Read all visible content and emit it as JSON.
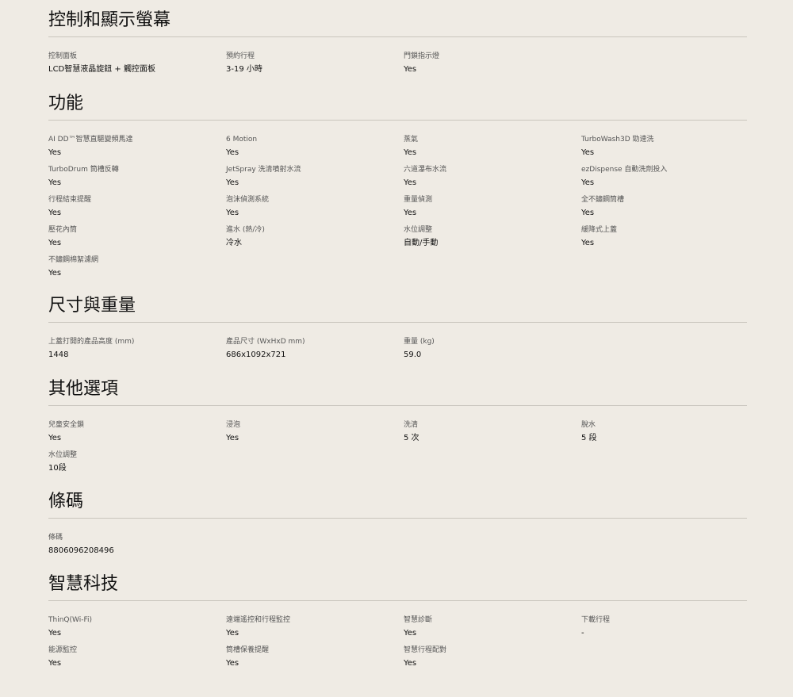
{
  "sections": [
    {
      "title": "控制和顯示螢幕",
      "specs": [
        {
          "label": "控制面板",
          "value": "LCD智慧液晶旋鈕 + 觸控面板"
        },
        {
          "label": "預約行程",
          "value": "3-19 小時"
        },
        {
          "label": "門鎖指示燈",
          "value": "Yes"
        }
      ]
    },
    {
      "title": "功能",
      "specs": [
        {
          "label": "AI DD™智慧直驅變頻馬達",
          "value": "Yes"
        },
        {
          "label": "6 Motion",
          "value": "Yes"
        },
        {
          "label": "蒸氣",
          "value": "Yes"
        },
        {
          "label": "TurboWash3D 勁速洗",
          "value": "Yes"
        },
        {
          "label": "TurboDrum 筒槽反轉",
          "value": "Yes"
        },
        {
          "label": "JetSpray 洗清噴射水流",
          "value": "Yes"
        },
        {
          "label": "六道瀑布水流",
          "value": "Yes"
        },
        {
          "label": "ezDispense 自動洗劑投入",
          "value": "Yes"
        },
        {
          "label": "行程結束提醒",
          "value": "Yes"
        },
        {
          "label": "泡沫偵測系統",
          "value": "Yes"
        },
        {
          "label": "重量偵測",
          "value": "Yes"
        },
        {
          "label": "全不鏽鋼筒槽",
          "value": "Yes"
        },
        {
          "label": "壓花內筒",
          "value": "Yes"
        },
        {
          "label": "進水 (熱/冷)",
          "value": "冷水"
        },
        {
          "label": "水位調整",
          "value": "自動/手動"
        },
        {
          "label": "緩降式上蓋",
          "value": "Yes"
        },
        {
          "label": "不鏽鋼棉絮濾網",
          "value": "Yes"
        }
      ]
    },
    {
      "title": "尺寸與重量",
      "specs": [
        {
          "label": "上蓋打開的產品高度 (mm)",
          "value": "1448"
        },
        {
          "label": "產品尺寸 (WxHxD mm)",
          "value": "686x1092x721"
        },
        {
          "label": "重量 (kg)",
          "value": "59.0"
        }
      ]
    },
    {
      "title": "其他選項",
      "specs": [
        {
          "label": "兒童安全鎖",
          "value": "Yes"
        },
        {
          "label": "浸泡",
          "value": "Yes"
        },
        {
          "label": "洗清",
          "value": "5 次"
        },
        {
          "label": "脫水",
          "value": "5 段"
        },
        {
          "label": "水位調整",
          "value": "10段"
        }
      ]
    },
    {
      "title": "條碼",
      "specs": [
        {
          "label": "條碼",
          "value": "8806096208496"
        }
      ]
    },
    {
      "title": "智慧科技",
      "specs": [
        {
          "label": "ThinQ(Wi-Fi)",
          "value": "Yes"
        },
        {
          "label": "遠端遙控和行程監控",
          "value": "Yes"
        },
        {
          "label": "智慧診斷",
          "value": "Yes"
        },
        {
          "label": "下載行程",
          "value": "-"
        },
        {
          "label": "能源監控",
          "value": "Yes"
        },
        {
          "label": "筒槽保養提醒",
          "value": "Yes"
        },
        {
          "label": "智慧行程配對",
          "value": "Yes"
        }
      ]
    }
  ]
}
